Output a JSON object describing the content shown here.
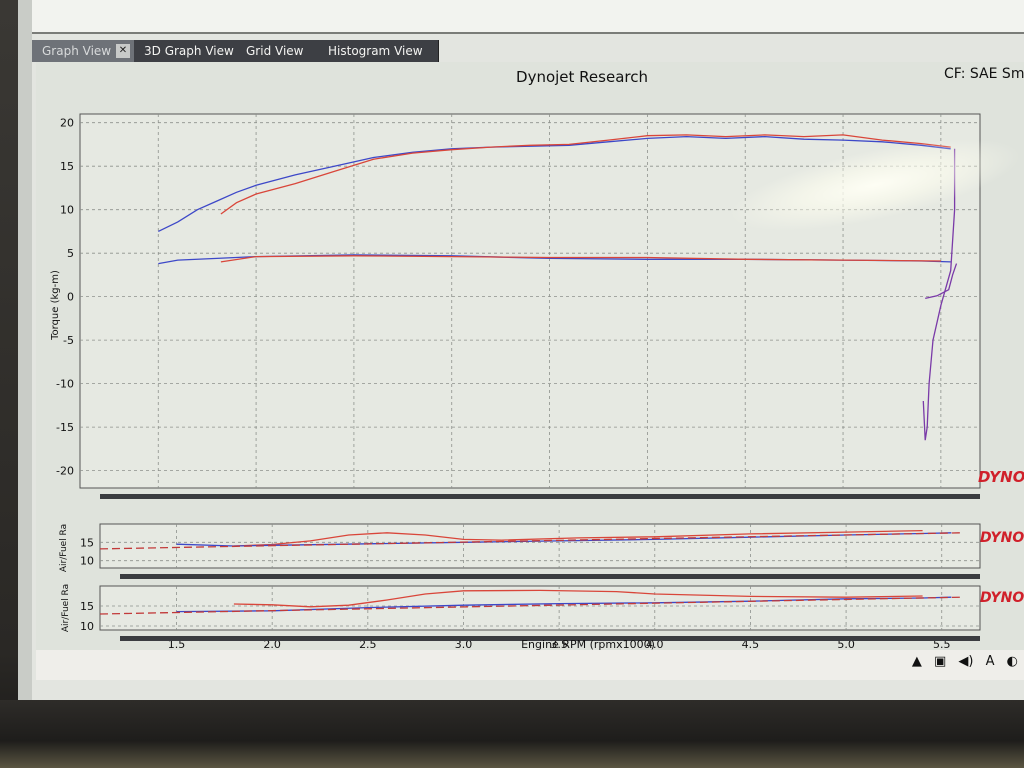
{
  "tabs": [
    {
      "label": "Graph View",
      "active": true
    },
    {
      "label": "3D Graph View",
      "active": false
    },
    {
      "label": "Grid View",
      "active": false
    },
    {
      "label": "Histogram View",
      "active": false
    }
  ],
  "header": {
    "title": "Dynojet Research",
    "cf": "CF: SAE Sm"
  },
  "brand": {
    "text": "DYNO",
    "color": "#d0202a"
  },
  "tray_icons": [
    "up-arrow-icon",
    "network-icon",
    "speaker-icon",
    "ime-a-icon",
    "clock-icon"
  ],
  "tray_text": {
    "ime": "A"
  },
  "colors": {
    "run_red": "#d9463a",
    "run_blue": "#3d48c8",
    "run_purple": "#7a3aa8",
    "reference_dash": "#c23a3a"
  },
  "chart_data": [
    {
      "type": "line",
      "panel": "torque",
      "ylabel": "Torque (kg-m)",
      "ylim": [
        -22,
        21
      ],
      "yticks": [
        20,
        15,
        10,
        5,
        0,
        -5,
        -10,
        -15,
        -20
      ],
      "xlim": [
        1.1,
        5.7
      ],
      "grid": true,
      "series": [
        {
          "color": "#3d48c8",
          "points": [
            [
              1.5,
              7.5
            ],
            [
              1.6,
              8.6
            ],
            [
              1.7,
              10.0
            ],
            [
              1.8,
              11.0
            ],
            [
              1.9,
              12.0
            ],
            [
              2.0,
              12.8
            ],
            [
              2.2,
              14.0
            ],
            [
              2.4,
              15.0
            ],
            [
              2.6,
              16.0
            ],
            [
              2.8,
              16.6
            ],
            [
              3.0,
              17.0
            ],
            [
              3.2,
              17.2
            ],
            [
              3.4,
              17.3
            ],
            [
              3.6,
              17.4
            ],
            [
              3.8,
              17.8
            ],
            [
              4.0,
              18.2
            ],
            [
              4.2,
              18.4
            ],
            [
              4.4,
              18.2
            ],
            [
              4.6,
              18.4
            ],
            [
              4.8,
              18.1
            ],
            [
              5.0,
              18.0
            ],
            [
              5.2,
              17.8
            ],
            [
              5.4,
              17.4
            ],
            [
              5.55,
              17.0
            ]
          ]
        },
        {
          "color": "#d9463a",
          "points": [
            [
              1.82,
              9.5
            ],
            [
              1.9,
              10.8
            ],
            [
              2.0,
              11.8
            ],
            [
              2.2,
              13.0
            ],
            [
              2.4,
              14.4
            ],
            [
              2.6,
              15.8
            ],
            [
              2.8,
              16.5
            ],
            [
              3.0,
              16.9
            ],
            [
              3.2,
              17.2
            ],
            [
              3.4,
              17.4
            ],
            [
              3.6,
              17.5
            ],
            [
              3.8,
              18.0
            ],
            [
              4.0,
              18.5
            ],
            [
              4.2,
              18.6
            ],
            [
              4.4,
              18.4
            ],
            [
              4.6,
              18.6
            ],
            [
              4.8,
              18.4
            ],
            [
              5.0,
              18.6
            ],
            [
              5.2,
              18.0
            ],
            [
              5.4,
              17.6
            ],
            [
              5.55,
              17.2
            ]
          ]
        },
        {
          "color": "#3d48c8",
          "points": [
            [
              1.5,
              3.8
            ],
            [
              1.6,
              4.2
            ],
            [
              1.8,
              4.4
            ],
            [
              2.0,
              4.6
            ],
            [
              2.5,
              4.8
            ],
            [
              3.0,
              4.7
            ],
            [
              3.5,
              4.4
            ],
            [
              4.0,
              4.3
            ],
            [
              4.5,
              4.3
            ],
            [
              5.0,
              4.2
            ],
            [
              5.4,
              4.1
            ],
            [
              5.55,
              4.0
            ]
          ]
        },
        {
          "color": "#d9463a",
          "points": [
            [
              1.82,
              4.0
            ],
            [
              2.0,
              4.6
            ],
            [
              2.5,
              4.7
            ],
            [
              3.0,
              4.6
            ],
            [
              3.5,
              4.5
            ],
            [
              4.0,
              4.5
            ],
            [
              4.5,
              4.3
            ],
            [
              5.0,
              4.2
            ],
            [
              5.5,
              4.1
            ]
          ]
        },
        {
          "color": "#7a3aa8",
          "points": [
            [
              5.57,
              17.0
            ],
            [
              5.57,
              10.0
            ],
            [
              5.55,
              3.0
            ],
            [
              5.5,
              -1.0
            ],
            [
              5.46,
              -5.0
            ],
            [
              5.44,
              -10.0
            ],
            [
              5.43,
              -15.0
            ],
            [
              5.42,
              -16.5
            ],
            [
              5.41,
              -12.0
            ]
          ]
        },
        {
          "color": "#7a3aa8",
          "points": [
            [
              5.42,
              -0.2
            ],
            [
              5.48,
              0.1
            ],
            [
              5.54,
              0.8
            ],
            [
              5.56,
              2.5
            ],
            [
              5.58,
              3.8
            ]
          ]
        }
      ]
    },
    {
      "type": "line",
      "panel": "afr1",
      "ylabel": "Air/Fuel Ra",
      "ylim": [
        8,
        20
      ],
      "yticks": [
        15,
        10
      ],
      "xlim": [
        1.1,
        5.7
      ],
      "grid": true,
      "series": [
        {
          "color": "#d9463a",
          "points": [
            [
              1.8,
              14.0
            ],
            [
              2.0,
              14.4
            ],
            [
              2.2,
              15.4
            ],
            [
              2.4,
              17.0
            ],
            [
              2.6,
              17.6
            ],
            [
              2.8,
              17.0
            ],
            [
              3.0,
              15.8
            ],
            [
              3.2,
              15.6
            ],
            [
              3.6,
              16.2
            ],
            [
              4.0,
              16.5
            ],
            [
              4.5,
              17.3
            ],
            [
              5.0,
              17.8
            ],
            [
              5.4,
              18.2
            ]
          ]
        },
        {
          "color": "#3d48c8",
          "points": [
            [
              1.5,
              14.5
            ],
            [
              1.8,
              14.0
            ],
            [
              2.0,
              14.2
            ],
            [
              2.5,
              14.6
            ],
            [
              3.0,
              15.0
            ],
            [
              3.5,
              15.4
            ],
            [
              4.0,
              15.8
            ],
            [
              4.5,
              16.4
            ],
            [
              5.0,
              17.0
            ],
            [
              5.4,
              17.4
            ],
            [
              5.55,
              17.6
            ]
          ]
        },
        {
          "color": "#c23a3a",
          "points": [
            [
              1.1,
              13.2
            ],
            [
              5.6,
              17.6
            ]
          ],
          "dashed": true
        }
      ]
    },
    {
      "type": "line",
      "panel": "afr2",
      "ylabel": "Air/Fuel Ra",
      "ylim": [
        9,
        20
      ],
      "yticks": [
        15,
        10
      ],
      "xlim": [
        1.1,
        5.7
      ],
      "grid": true,
      "xlabel": "Engine RPM (rpmx1000)",
      "xticks": [
        1.5,
        2.0,
        2.5,
        3.0,
        3.5,
        4.0,
        4.5,
        5.0,
        5.5
      ],
      "series": [
        {
          "color": "#d9463a",
          "points": [
            [
              1.8,
              15.5
            ],
            [
              2.0,
              15.3
            ],
            [
              2.2,
              14.8
            ],
            [
              2.4,
              15.2
            ],
            [
              2.6,
              16.5
            ],
            [
              2.8,
              18.0
            ],
            [
              3.0,
              18.8
            ],
            [
              3.4,
              18.9
            ],
            [
              3.8,
              18.6
            ],
            [
              4.0,
              18.0
            ],
            [
              4.5,
              17.4
            ],
            [
              5.0,
              17.2
            ],
            [
              5.4,
              17.5
            ]
          ]
        },
        {
          "color": "#3d48c8",
          "points": [
            [
              1.5,
              13.6
            ],
            [
              2.0,
              13.8
            ],
            [
              2.5,
              14.6
            ],
            [
              3.0,
              15.2
            ],
            [
              3.5,
              15.6
            ],
            [
              4.0,
              15.8
            ],
            [
              4.5,
              16.2
            ],
            [
              5.0,
              16.8
            ],
            [
              5.4,
              17.0
            ],
            [
              5.55,
              17.2
            ]
          ]
        },
        {
          "color": "#c23a3a",
          "points": [
            [
              1.1,
              13.0
            ],
            [
              5.6,
              17.2
            ]
          ],
          "dashed": true
        }
      ]
    }
  ]
}
